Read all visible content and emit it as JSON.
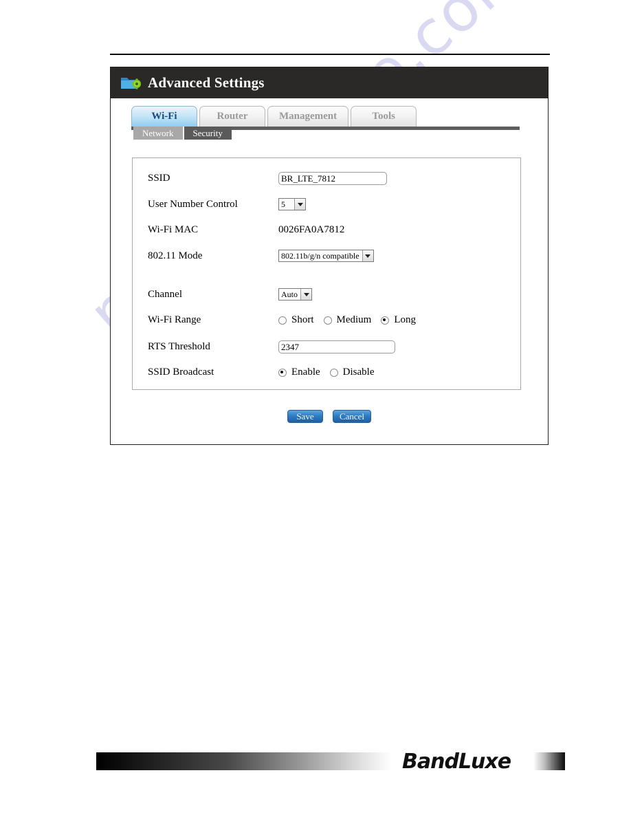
{
  "watermark": {
    "text": "manualshive.com"
  },
  "app": {
    "title": "Advanced Settings",
    "header_icon": "folder-gear-icon"
  },
  "tabs": [
    {
      "label": "Wi-Fi",
      "active": true
    },
    {
      "label": "Router",
      "active": false
    },
    {
      "label": "Management",
      "active": false
    },
    {
      "label": "Tools",
      "active": false
    }
  ],
  "subtabs": [
    {
      "label": "Network",
      "active": true
    },
    {
      "label": "Security",
      "active": false
    }
  ],
  "form": {
    "ssid": {
      "label": "SSID",
      "value": "BR_LTE_7812",
      "placeholder": "SSID"
    },
    "user_number_control": {
      "label": "User Number Control",
      "value": "5"
    },
    "wifi_mac": {
      "label": "Wi-Fi MAC",
      "value": "0026FA0A7812"
    },
    "mode_802_11": {
      "label": "802.11 Mode",
      "value": "802.11b/g/n compatible"
    },
    "channel": {
      "label": "Channel",
      "value": "Auto"
    },
    "wifi_range": {
      "label": "Wi-Fi Range",
      "options": [
        {
          "label": "Short",
          "selected": false
        },
        {
          "label": "Medium",
          "selected": false
        },
        {
          "label": "Long",
          "selected": true
        }
      ]
    },
    "rts_threshold": {
      "label": "RTS Threshold",
      "value": "2347",
      "placeholder": "RTS Threshold"
    },
    "ssid_broadcast": {
      "label": "SSID Broadcast",
      "options": [
        {
          "label": "Enable",
          "selected": true
        },
        {
          "label": "Disable",
          "selected": false
        }
      ]
    }
  },
  "buttons": {
    "save": "Save",
    "cancel": "Cancel"
  },
  "footer": {
    "brand": "BandLuxe"
  },
  "colors": {
    "header_bg": "#2b2927",
    "active_tab": "#8fcdf0",
    "active_tab_text": "#1a4a7a",
    "button_blue": "#2f7ec4",
    "watermark": "#d9d9f2",
    "subtab_active": "#a8a8a8",
    "subtab_inactive": "#5a5a5a"
  }
}
